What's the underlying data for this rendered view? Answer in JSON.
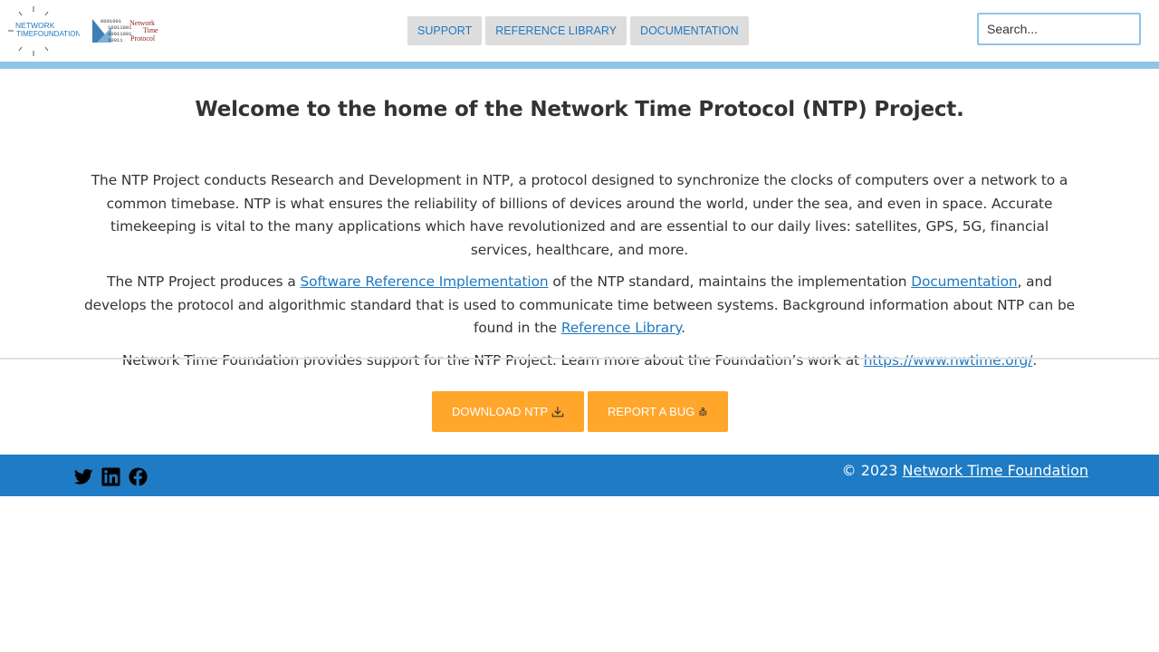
{
  "header": {
    "logo_nwtf": {
      "line1": "NETWORK",
      "line2": "TIME",
      "line3": "FOUNDATION"
    },
    "logo_ntp": {
      "binary": [
        "0001001",
        "10011001",
        "10011001",
        "10011"
      ],
      "line1": "Network",
      "line2": "Time",
      "line3": "Protocol"
    },
    "nav": {
      "support": "SUPPORT",
      "reference_library": "REFERENCE LIBRARY",
      "documentation": "DOCUMENTATION"
    },
    "search": {
      "placeholder": "Search...",
      "value": ""
    }
  },
  "main": {
    "title": "Welcome to the home of the Network Time Protocol (NTP) Project.",
    "p1": "The NTP Project conducts Research and Development in NTP, a protocol designed to synchronize the clocks of computers over a network to a common timebase. NTP is what ensures the reliability of billions of devices around the world, under the sea, and even in space. Accurate timekeeping is vital to the many applications which have revolutionized and are essential to our daily lives: satellites, GPS, 5G, financial services, healthcare, and more.",
    "p2": {
      "t1": "The NTP Project produces a ",
      "link1": "Software Reference Implementation",
      "t2": " of the NTP standard, maintains the implementation ",
      "link2": "Documentation",
      "t3": ", and develops the protocol and algorithmic standard that is used to communicate time between systems. Background information about NTP can be found in the ",
      "link3": "Reference Library",
      "t4": "."
    },
    "p3": {
      "t1": "Network Time Foundation provides support for the NTP Project. Learn more about the Foundation’s work at ",
      "link": "https://www.nwtime.org/",
      "t2": "."
    }
  },
  "actions": {
    "download": "DOWNLOAD NTP",
    "report_bug": "REPORT A BUG"
  },
  "footer": {
    "social": [
      "twitter-icon",
      "linkedin-icon",
      "facebook-icon"
    ],
    "copyright_prefix": "© 2023 ",
    "copyright_link": "Network Time Foundation"
  },
  "colors": {
    "accent_blue": "#1e78c2",
    "light_blue": "#8ec6e8",
    "orange": "#ffa62b",
    "footer_blue": "#1e7bc4"
  }
}
